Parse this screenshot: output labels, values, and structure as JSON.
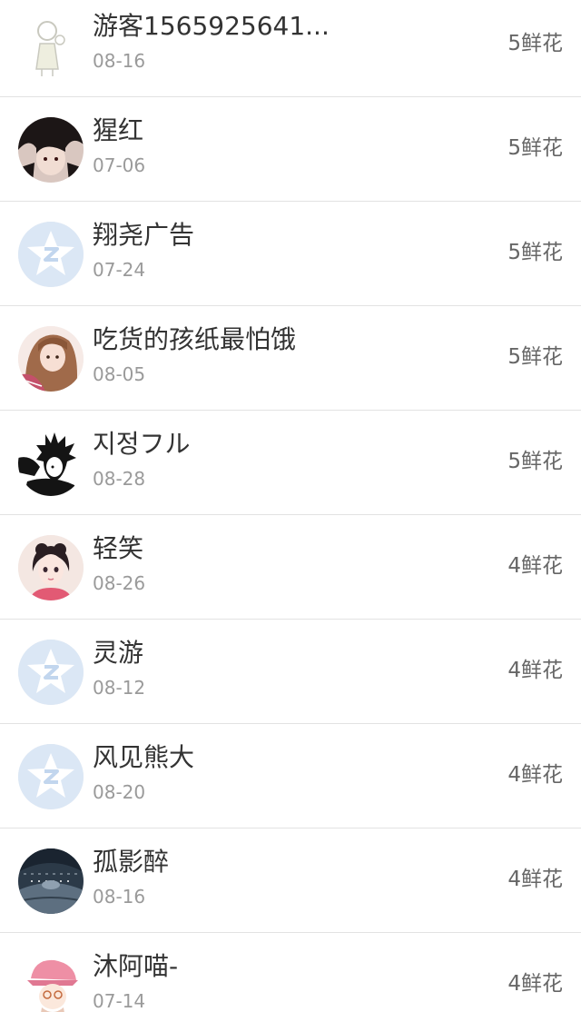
{
  "records": [
    {
      "name": "游客1565925641...",
      "date": "08-16",
      "flowers": "5鲜花",
      "avatar": "sketch-girl-avatar"
    },
    {
      "name": "猩红",
      "date": "07-06",
      "flowers": "5鲜花",
      "avatar": "dark-hair-avatar"
    },
    {
      "name": "翔尧广告",
      "date": "07-24",
      "flowers": "5鲜花",
      "avatar": "default-qq-avatar"
    },
    {
      "name": "吃货的孩纸最怕饿",
      "date": "08-05",
      "flowers": "5鲜花",
      "avatar": "girl-photo-avatar"
    },
    {
      "name": "지정フル",
      "date": "08-28",
      "flowers": "5鲜花",
      "avatar": "manga-avatar"
    },
    {
      "name": "轻笑",
      "date": "08-26",
      "flowers": "4鲜花",
      "avatar": "anime-girl-avatar"
    },
    {
      "name": "灵游",
      "date": "08-12",
      "flowers": "4鲜花",
      "avatar": "default-qq-avatar"
    },
    {
      "name": "风见熊大",
      "date": "08-20",
      "flowers": "4鲜花",
      "avatar": "default-qq-avatar"
    },
    {
      "name": "孤影醉",
      "date": "08-16",
      "flowers": "4鲜花",
      "avatar": "tunnel-photo-avatar"
    },
    {
      "name": "沐阿喵-",
      "date": "07-14",
      "flowers": "4鲜花",
      "avatar": "pink-hat-avatar"
    }
  ]
}
